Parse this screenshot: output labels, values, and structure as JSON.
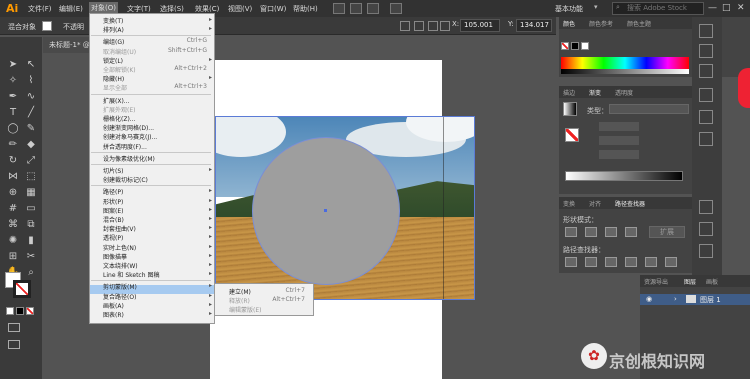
{
  "app_logo": "Ai",
  "menubar": [
    "文件(F)",
    "编辑(E)",
    "对象(O)",
    "文字(T)",
    "选择(S)",
    "效果(C)",
    "视图(V)",
    "窗口(W)",
    "帮助(H)"
  ],
  "workspace": "基本功能",
  "search_placeholder": "搜索 Adobe Stock",
  "window_buttons": {
    "minimize": "—",
    "maximize": "□",
    "close": "✕"
  },
  "control_bar": {
    "no_selection": "混合对象",
    "opacity_label": "不透明",
    "x_label": "X:",
    "x_value": "105.001",
    "y_label": "Y:",
    "y_value": "134.017"
  },
  "document_tab": "未标题-1* @",
  "object_menu": [
    {
      "label": "变换(T)",
      "arrow": true
    },
    {
      "label": "排列(A)",
      "arrow": true
    },
    {
      "sep": true
    },
    {
      "label": "编组(G)",
      "shortcut": "Ctrl+G"
    },
    {
      "label": "取消编组(U)",
      "shortcut": "Shift+Ctrl+G",
      "disabled": true
    },
    {
      "label": "锁定(L)",
      "arrow": true
    },
    {
      "label": "全部解锁(K)",
      "shortcut": "Alt+Ctrl+2",
      "disabled": true
    },
    {
      "label": "隐藏(H)",
      "arrow": true
    },
    {
      "label": "显示全部",
      "shortcut": "Alt+Ctrl+3",
      "disabled": true
    },
    {
      "sep": true
    },
    {
      "label": "扩展(X)..."
    },
    {
      "label": "扩展外观(E)",
      "disabled": true
    },
    {
      "label": "栅格化(Z)..."
    },
    {
      "label": "创建渐变网格(D)..."
    },
    {
      "label": "创建对象马赛克(J)..."
    },
    {
      "label": "拼合透明度(F)..."
    },
    {
      "sep": true
    },
    {
      "label": "设为像素级优化(M)"
    },
    {
      "sep": true
    },
    {
      "label": "切片(S)",
      "arrow": true
    },
    {
      "label": "创建裁切标记(C)"
    },
    {
      "sep": true
    },
    {
      "label": "路径(P)",
      "arrow": true
    },
    {
      "label": "形状(P)",
      "arrow": true
    },
    {
      "label": "图案(E)",
      "arrow": true
    },
    {
      "label": "混合(B)",
      "arrow": true
    },
    {
      "label": "封套扭曲(V)",
      "arrow": true
    },
    {
      "label": "透视(P)",
      "arrow": true
    },
    {
      "label": "实时上色(N)",
      "arrow": true
    },
    {
      "label": "图像描摹",
      "arrow": true
    },
    {
      "label": "文本绕排(W)",
      "arrow": true
    },
    {
      "label": "Line 和 Sketch 图稿",
      "arrow": true
    },
    {
      "sep": true
    },
    {
      "label": "剪切蒙版(M)",
      "arrow": true,
      "highlighted": true
    },
    {
      "label": "复合路径(O)",
      "arrow": true
    },
    {
      "label": "画板(A)",
      "arrow": true
    },
    {
      "label": "图表(R)",
      "arrow": true
    }
  ],
  "clip_submenu": [
    {
      "label": "建立(M)",
      "shortcut": "Ctrl+7"
    },
    {
      "label": "释放(R)",
      "shortcut": "Alt+Ctrl+7",
      "disabled": true
    },
    {
      "label": "编辑蒙版(E)",
      "disabled": true
    }
  ],
  "panels": {
    "color_tabs": [
      "颜色",
      "颜色参考",
      "颜色主题"
    ],
    "gradient_tabs": [
      "描边",
      "渐变",
      "透明度"
    ],
    "gradient_type_label": "类型：",
    "transform_tabs": [
      "变换",
      "对齐",
      "路径查找器"
    ],
    "shape_modes_label": "形状模式：",
    "expand_button": "扩展",
    "pathfinder_label": "路径查找器：",
    "layers_tabs": [
      "资源导出",
      "图层",
      "画板"
    ],
    "layer_name": "图层 1"
  },
  "watermark": "京创根知识网"
}
